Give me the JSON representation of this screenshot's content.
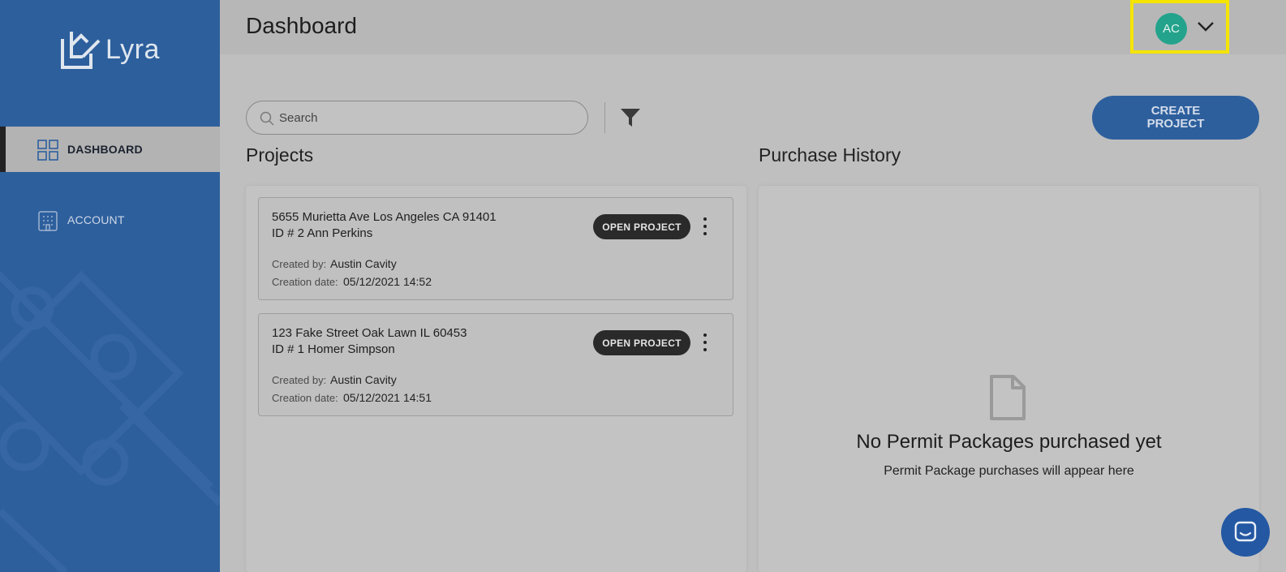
{
  "app": {
    "logo_text": "Lyra"
  },
  "sidebar": {
    "items": [
      {
        "label": "DASHBOARD",
        "icon": "grid-icon",
        "active": true
      },
      {
        "label": "ACCOUNT",
        "icon": "building-icon",
        "active": false
      }
    ]
  },
  "header": {
    "title": "Dashboard",
    "user_initials": "AC",
    "avatar_color": "#23a38c",
    "highlight_color": "#f5e400"
  },
  "toolbar": {
    "search_placeholder": "Search",
    "create_label_line1": "CREATE",
    "create_label_line2": "PROJECT"
  },
  "projects": {
    "title": "Projects",
    "open_label": "OPEN PROJECT",
    "created_by_label": "Created by:",
    "creation_date_label": "Creation date:",
    "items": [
      {
        "address": "5655 Murietta Ave Los Angeles CA 91401",
        "id_line": "ID # 2 Ann Perkins",
        "created_by": "Austin Cavity",
        "creation_date": "05/12/2021 14:52"
      },
      {
        "address": "123 Fake Street Oak Lawn IL 60453",
        "id_line": "ID # 1 Homer Simpson",
        "created_by": "Austin Cavity",
        "creation_date": "05/12/2021 14:51"
      }
    ]
  },
  "purchase_history": {
    "title": "Purchase History",
    "empty_title": "No Permit Packages purchased yet",
    "empty_subtitle": "Permit Package purchases will appear here"
  },
  "colors": {
    "brand": "#2d5f9d",
    "chat": "#2458a3"
  }
}
